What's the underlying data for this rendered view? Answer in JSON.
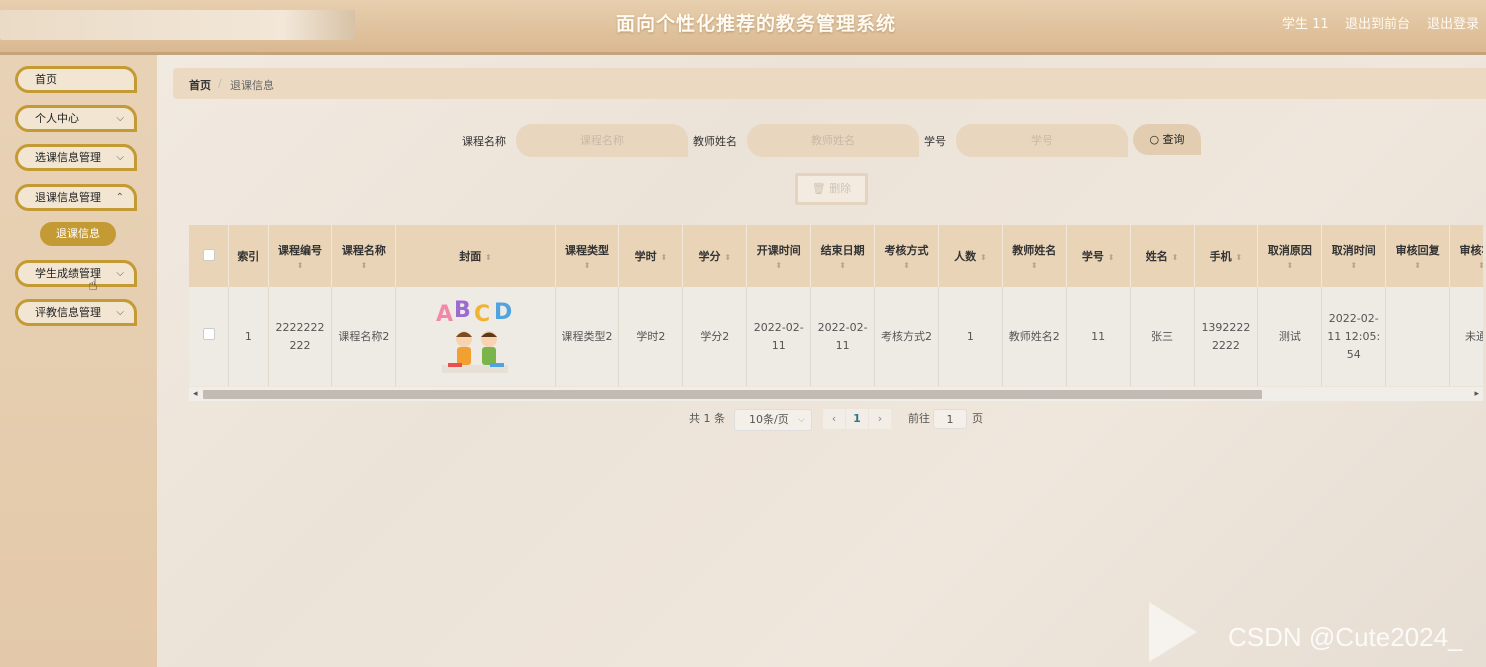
{
  "header": {
    "title": "面向个性化推荐的教务管理系统",
    "user": "学生 11",
    "front_link": "退出到前台",
    "logout_link": "退出登录"
  },
  "sidebar": {
    "items": [
      {
        "label": "首页"
      },
      {
        "label": "个人中心"
      },
      {
        "label": "选课信息管理"
      },
      {
        "label": "退课信息管理"
      },
      {
        "label": "学生成绩管理"
      },
      {
        "label": "评教信息管理"
      }
    ],
    "sub_item": "退课信息"
  },
  "breadcrumb": {
    "home": "首页",
    "sep": "/",
    "current": "退课信息"
  },
  "search": {
    "course_label": "课程名称",
    "course_placeholder": "课程名称",
    "teacher_label": "教师姓名",
    "teacher_placeholder": "教师姓名",
    "student_label": "学号",
    "student_placeholder": "学号",
    "button": "查询"
  },
  "delete_button": "删除",
  "table": {
    "columns": [
      "索引",
      "课程编号",
      "课程名称",
      "封面",
      "课程类型",
      "学时",
      "学分",
      "开课时间",
      "结束日期",
      "考核方式",
      "人数",
      "教师姓名",
      "学号",
      "姓名",
      "手机",
      "取消原因",
      "取消时间",
      "审核回复",
      "审核状态"
    ],
    "row": {
      "index": "1",
      "course_no": "2222222222",
      "course_name": "课程名称2",
      "cover_text": "ABCD",
      "course_type": "课程类型2",
      "hours": "学时2",
      "credits": "学分2",
      "start": "2022-02-11",
      "end": "2022-02-11",
      "exam": "考核方式2",
      "people": "1",
      "teacher": "教师姓名2",
      "student_no": "11",
      "name": "张三",
      "phone": "13922222222",
      "reason": "测试",
      "cancel_time": "2022-02-11 12:05:54",
      "reply": "",
      "status": "未通过"
    }
  },
  "pager": {
    "total": "共 1 条",
    "page_size": "10条/页",
    "current": "1",
    "goto_label": "前往",
    "goto_value": "1",
    "page_suffix": "页"
  },
  "watermark": "CSDN @Cute2024_",
  "colors": {
    "accent": "#c49a35",
    "header": "#d9b992",
    "table_header": "#e9d4b7"
  }
}
